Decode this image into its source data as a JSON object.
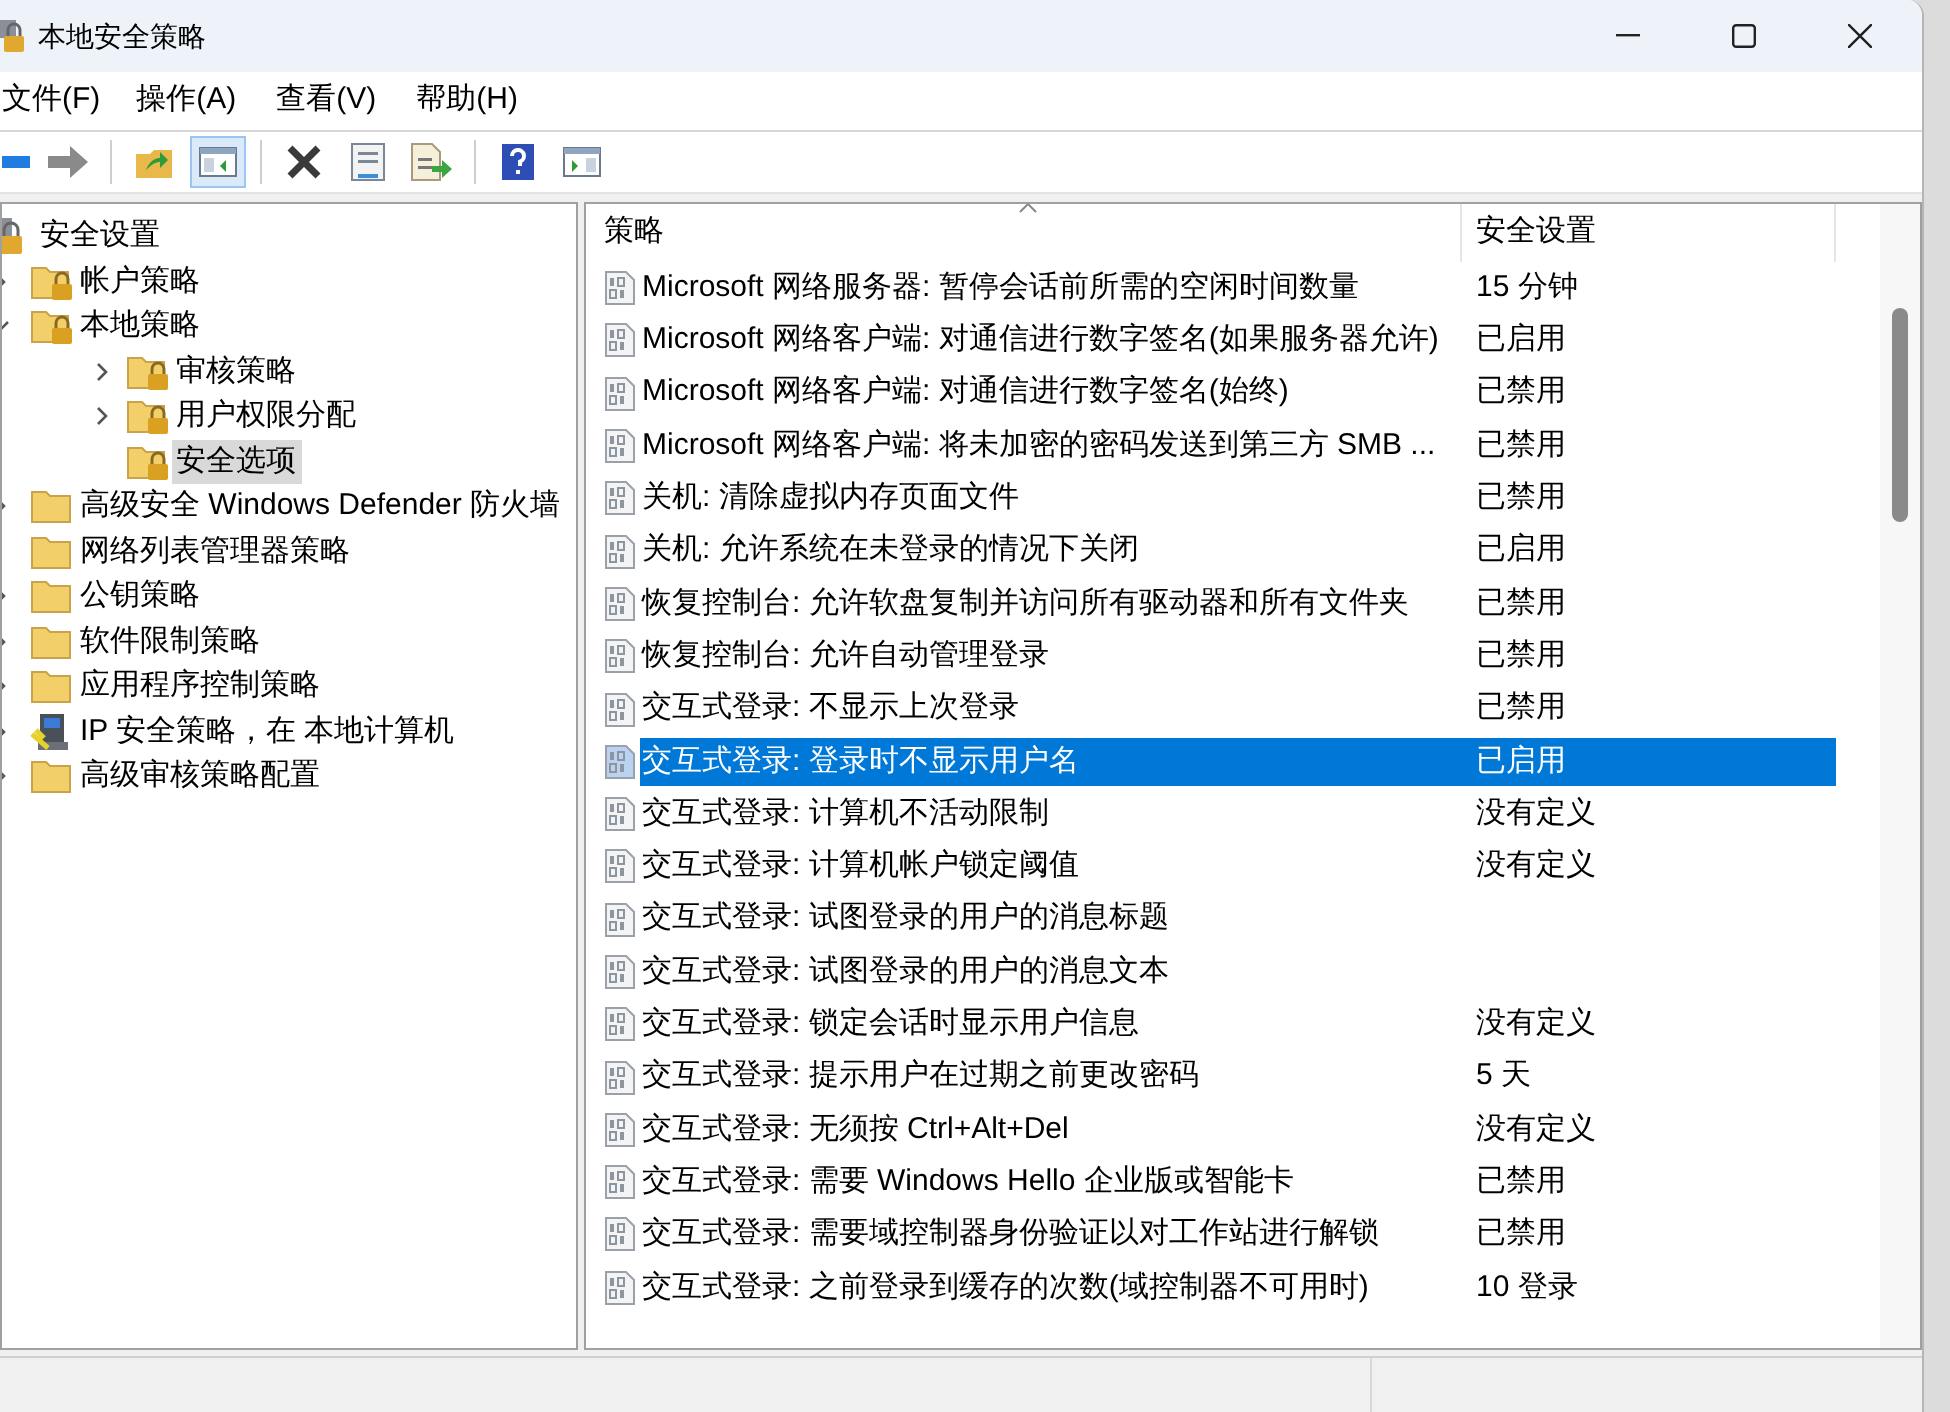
{
  "window": {
    "title": "本地安全策略"
  },
  "menu": [
    "文件(F)",
    "操作(A)",
    "查看(V)",
    "帮助(H)"
  ],
  "toolbar": [
    {
      "kind": "back",
      "selected": false
    },
    {
      "kind": "forward",
      "selected": false
    },
    {
      "kind": "up",
      "selected": false
    },
    {
      "kind": "tree",
      "selected": true
    },
    {
      "kind": "delete",
      "selected": false
    },
    {
      "kind": "properties",
      "selected": false
    },
    {
      "kind": "export",
      "selected": false
    },
    {
      "kind": "help",
      "selected": false
    },
    {
      "kind": "action-pane",
      "selected": false
    }
  ],
  "tree": [
    {
      "label": "安全设置",
      "kind": "secure",
      "selected": false,
      "children": [
        {
          "label": "帐户策略",
          "kind": "lock-folder",
          "expandable": true,
          "expanded": false,
          "selected": false
        },
        {
          "label": "本地策略",
          "kind": "lock-folder",
          "expandable": true,
          "expanded": true,
          "selected": false,
          "children": [
            {
              "label": "审核策略",
              "kind": "lock-folder",
              "expandable": true,
              "expanded": false,
              "selected": false
            },
            {
              "label": "用户权限分配",
              "kind": "lock-folder",
              "expandable": true,
              "expanded": false,
              "selected": false
            },
            {
              "label": "安全选项",
              "kind": "lock-folder",
              "expandable": false,
              "selected": true
            }
          ]
        },
        {
          "label": "高级安全 Windows Defender 防火墙",
          "kind": "folder",
          "expandable": true,
          "expanded": false,
          "selected": false
        },
        {
          "label": "网络列表管理器策略",
          "kind": "folder",
          "expandable": false,
          "selected": false
        },
        {
          "label": "公钥策略",
          "kind": "folder",
          "expandable": true,
          "expanded": false,
          "selected": false
        },
        {
          "label": "软件限制策略",
          "kind": "folder",
          "expandable": true,
          "expanded": false,
          "selected": false
        },
        {
          "label": "应用程序控制策略",
          "kind": "folder",
          "expandable": true,
          "expanded": false,
          "selected": false
        },
        {
          "label": "IP 安全策略，在 本地计算机",
          "kind": "ip",
          "expandable": true,
          "expanded": false,
          "selected": false
        },
        {
          "label": "高级审核策略配置",
          "kind": "folder",
          "expandable": true,
          "expanded": false,
          "selected": false
        }
      ]
    }
  ],
  "table": {
    "columns": [
      {
        "label": "策略",
        "sorted": true
      },
      {
        "label": "安全设置",
        "sorted": false
      }
    ],
    "rows": [
      {
        "policy": "Microsoft 网络服务器: 暂停会话前所需的空闲时间数量",
        "setting": "15 分钟",
        "selected": false
      },
      {
        "policy": "Microsoft 网络客户端: 对通信进行数字签名(如果服务器允许)",
        "setting": "已启用",
        "selected": false
      },
      {
        "policy": "Microsoft 网络客户端: 对通信进行数字签名(始终)",
        "setting": "已禁用",
        "selected": false
      },
      {
        "policy": "Microsoft 网络客户端: 将未加密的密码发送到第三方 SMB ...",
        "setting": "已禁用",
        "selected": false
      },
      {
        "policy": "关机: 清除虚拟内存页面文件",
        "setting": "已禁用",
        "selected": false
      },
      {
        "policy": "关机: 允许系统在未登录的情况下关闭",
        "setting": "已启用",
        "selected": false
      },
      {
        "policy": "恢复控制台: 允许软盘复制并访问所有驱动器和所有文件夹",
        "setting": "已禁用",
        "selected": false
      },
      {
        "policy": "恢复控制台: 允许自动管理登录",
        "setting": "已禁用",
        "selected": false
      },
      {
        "policy": "交互式登录: 不显示上次登录",
        "setting": "已禁用",
        "selected": false
      },
      {
        "policy": "交互式登录: 登录时不显示用户名",
        "setting": "已启用",
        "selected": true
      },
      {
        "policy": "交互式登录: 计算机不活动限制",
        "setting": "没有定义",
        "selected": false
      },
      {
        "policy": "交互式登录: 计算机帐户锁定阈值",
        "setting": "没有定义",
        "selected": false
      },
      {
        "policy": "交互式登录: 试图登录的用户的消息标题",
        "selected": false
      },
      {
        "policy": "交互式登录: 试图登录的用户的消息文本",
        "selected": false
      },
      {
        "policy": "交互式登录: 锁定会话时显示用户信息",
        "setting": "没有定义",
        "selected": false
      },
      {
        "policy": "交互式登录: 提示用户在过期之前更改密码",
        "setting": "5 天",
        "selected": false
      },
      {
        "policy": "交互式登录: 无须按 Ctrl+Alt+Del",
        "setting": "没有定义",
        "selected": false
      },
      {
        "policy": "交互式登录: 需要 Windows Hello 企业版或智能卡",
        "setting": "已禁用",
        "selected": false
      },
      {
        "policy": "交互式登录: 需要域控制器身份验证以对工作站进行解锁",
        "setting": "已禁用",
        "selected": false
      },
      {
        "policy": "交互式登录: 之前登录到缓存的次数(域控制器不可用时)",
        "setting": "10 登录",
        "selected": false
      }
    ]
  }
}
